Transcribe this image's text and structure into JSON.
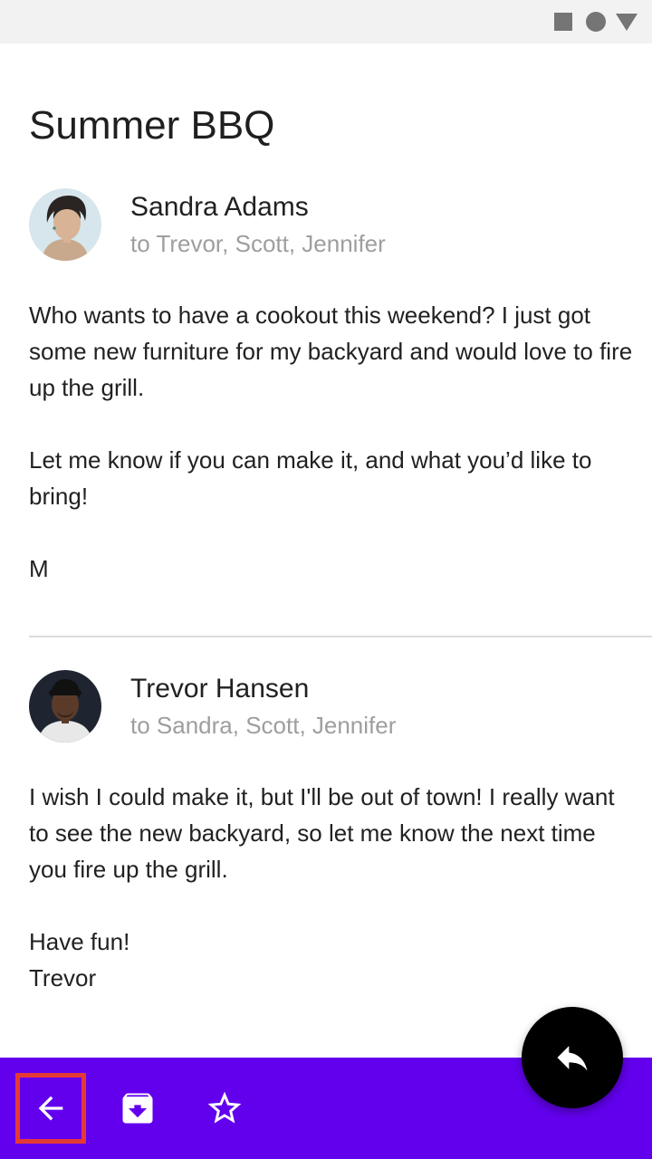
{
  "status_bar": {
    "icons": [
      "square-icon",
      "circle-icon",
      "triangle-icon"
    ]
  },
  "email": {
    "subject": "Summer BBQ",
    "messages": [
      {
        "sender": "Sandra Adams",
        "recipients": "to Trevor, Scott, Jennifer",
        "body": [
          "Who wants to have a cookout this weekend? I just got some new furniture for my backyard and would love to fire up the grill.",
          "Let me know if you can make it, and what you’d like to bring!",
          "M"
        ]
      },
      {
        "sender": "Trevor Hansen",
        "recipients": "to Sandra, Scott, Jennifer",
        "body": [
          "I wish I could make it, but I'll be out of town! I really want to see the new backyard, so let me know the next time you fire up the grill.",
          "Have fun!",
          "Trevor"
        ]
      }
    ]
  },
  "bottom_bar": {
    "color": "#6200ee",
    "actions": [
      "back-arrow-icon",
      "archive-icon",
      "star-outline-icon"
    ],
    "highlighted_action": "back-arrow-icon"
  },
  "fab": {
    "icon": "reply-icon",
    "color": "#000000"
  }
}
